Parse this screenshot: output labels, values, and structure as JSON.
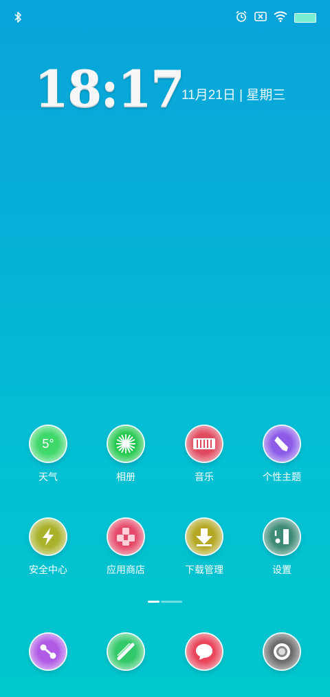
{
  "status": {
    "icons": [
      "bluetooth-icon",
      "alarm-icon",
      "no-sim-icon",
      "wifi-icon",
      "battery-icon"
    ],
    "battery_color": "#7af0d2"
  },
  "lockclock": {
    "time": "18:17",
    "date": "11月21日 | 星期三"
  },
  "apps_row1": [
    {
      "label": "天气",
      "icon": "weather-icon",
      "badge": "5°",
      "color": "#3fd86b"
    },
    {
      "label": "相册",
      "icon": "gallery-icon",
      "color": "#22c84d"
    },
    {
      "label": "音乐",
      "icon": "music-icon",
      "color": "#e04a5e"
    },
    {
      "label": "个性主题",
      "icon": "theme-icon",
      "color": "#8c5ce8"
    }
  ],
  "apps_row2": [
    {
      "label": "安全中心",
      "icon": "security-icon",
      "color": "#a8b22b"
    },
    {
      "label": "应用商店",
      "icon": "app-store-icon",
      "color": "#e54a6a"
    },
    {
      "label": "下载管理",
      "icon": "download-icon",
      "color": "#b4a825"
    },
    {
      "label": "设置",
      "icon": "settings-icon",
      "color": "#3d8a77"
    }
  ],
  "dock": [
    {
      "icon": "share-icon",
      "color": "#b05ae6"
    },
    {
      "icon": "browser-icon",
      "color": "#33c96b"
    },
    {
      "icon": "message-icon",
      "color": "#e9455b"
    },
    {
      "icon": "camera-icon",
      "color": "#6c6c6c"
    }
  ]
}
